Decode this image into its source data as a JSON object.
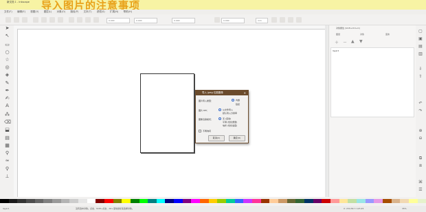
{
  "banner": {
    "text": "导入图片的注意事项"
  },
  "window": {
    "title": "新文档 1 - Inkscape"
  },
  "menu": [
    "文件(F)",
    "编辑(E)",
    "视图(V)",
    "图层(L)",
    "对象(O)",
    "路径(P)",
    "文本(T)",
    "滤镜(S)",
    "扩展(N)",
    "帮助(H)"
  ],
  "toolbar": {
    "x_value": "0.000",
    "y_value": "0.000",
    "w_value": "0.000",
    "h_value": "0.000",
    "unit": "mm"
  },
  "dialog": {
    "title": "导入 jpeg 位图图像",
    "type_label": "图片导入类型：",
    "type_opt1": "内嵌",
    "type_opt2": "链接",
    "dpi_label": "图片 DPI：",
    "dpi_opt1": "从文件导入",
    "dpi_opt2": "默认导入分辨率",
    "render_label": "图像渲染模式：",
    "render_opt1": "无 (自动)",
    "render_opt2": "平滑 (优化质量)",
    "render_opt3": "块状 (优化速度)",
    "dont_ask": "不再询问",
    "cancel": "取消(C)",
    "ok": "确定(O)"
  },
  "right_panel": {
    "title": "对象属性 (Shift+Ctrl+O)",
    "tab1": "图层",
    "tab2": "对象",
    "tab3": "变换",
    "list_item": "layer1"
  },
  "status": {
    "layer": "layer1",
    "message": "没有选中对象。点击、Shift+点击、Alt+滚动鼠标来选择对象。",
    "coords": "X: 234.56  Y: 123.45",
    "zoom": "35%"
  },
  "palette_colors": [
    "#000000",
    "#1a1a1a",
    "#333333",
    "#4d4d4d",
    "#666666",
    "#808080",
    "#999999",
    "#b3b3b3",
    "#cccccc",
    "#e6e6e6",
    "#ffffff",
    "#800000",
    "#ff0000",
    "#808000",
    "#ffff00",
    "#008000",
    "#00ff00",
    "#008080",
    "#00ffff",
    "#000080",
    "#0000ff",
    "#800080",
    "#ff00ff",
    "#ff6600",
    "#ffcc00",
    "#99cc00",
    "#00cc99",
    "#3366ff",
    "#cc33ff",
    "#ff3399",
    "#993300",
    "#ffcc99",
    "#cc9966",
    "#666633",
    "#336633",
    "#003366",
    "#660066",
    "#cc0000",
    "#ff9999",
    "#ffe699",
    "#c2e0a3",
    "#99e6e6",
    "#9999ff",
    "#e699e6",
    "#a64d00",
    "#d9b38c",
    "#f2d9b3",
    "#ffff99",
    "#e6f2cc"
  ]
}
